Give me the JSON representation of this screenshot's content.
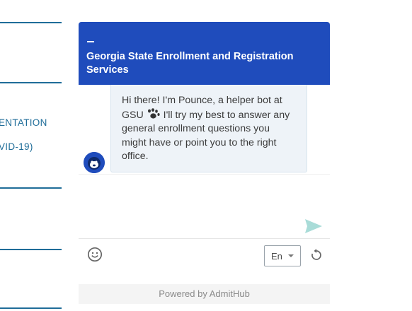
{
  "background": {
    "links": [
      "ENTATION",
      "VID-19)"
    ]
  },
  "chat": {
    "header": {
      "title": "Georgia State Enrollment and Registration Services",
      "minimize_icon": "minimize-icon",
      "color": "#1f4cbc"
    },
    "message": {
      "line1": "Hi there! I'm Pounce, a helper bot at",
      "line2_prefix": "GSU",
      "line2_suffix": " I'll try my best to answer any",
      "line3": "general enrollment questions you",
      "line4": "might have or point you to the right",
      "line5": "office."
    },
    "icons": {
      "avatar": "pounce-avatar-icon",
      "paw": "paw-icon",
      "send": "send-icon",
      "emoji": "emoji-icon",
      "refresh": "refresh-icon"
    },
    "language": {
      "selected": "En"
    },
    "footer": "Powered by AdmitHub"
  }
}
